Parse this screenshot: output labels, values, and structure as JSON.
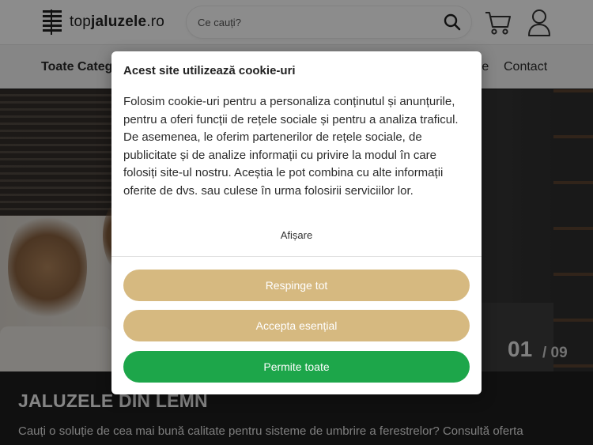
{
  "header": {
    "logo_light": "top",
    "logo_bold": "jaluzele",
    "logo_suffix": ".ro",
    "search_placeholder": "Ce cauți?",
    "icons": {
      "search": "search-icon",
      "cart": "cart-icon",
      "user": "user-icon"
    }
  },
  "nav": {
    "categories_label": "Toate Categ",
    "partial_label": "re",
    "contact_label": "Contact"
  },
  "hero": {
    "slide_current": "01",
    "slide_total": "/ 09",
    "title": "JALUZELE DIN LEMN",
    "description": "Cauți o soluție de cea mai bună calitate pentru sisteme de umbrire a ferestrelor? Consultă oferta"
  },
  "cookie_modal": {
    "title": "Acest site utilizează cookie-uri",
    "body": "Folosim cookie-uri pentru a personaliza conținutul și anunțurile, pentru a oferi funcții de rețele sociale și pentru a analiza traficul. De asemenea, le oferim partenerilor de rețele sociale, de publicitate și de analize informații cu privire la modul în care folosiți site-ul nostru. Aceștia le pot combina cu alte informații oferite de dvs. sau culese în urma folosirii serviciilor lor.",
    "details_link": "Afișare",
    "reject_label": "Respinge tot",
    "essential_label": "Accepta esențial",
    "accept_all_label": "Permite toate"
  },
  "colors": {
    "accent_gold": "#d6b980",
    "accept_green": "#1da64a"
  }
}
